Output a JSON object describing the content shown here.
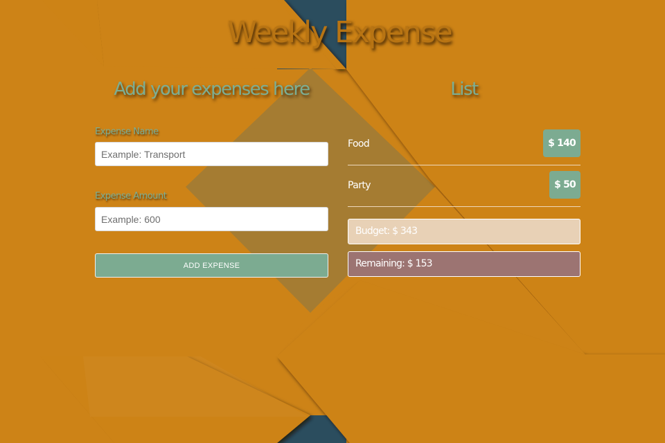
{
  "page": {
    "title": "Weekly Expense"
  },
  "form": {
    "heading": "Add your expenses here",
    "name_label": "Expense Name",
    "name_placeholder": "Example: Transport",
    "name_value": "",
    "amount_label": "Expense Amount",
    "amount_placeholder": "Example: 600",
    "amount_value": "",
    "submit_label": "ADD EXPENSE"
  },
  "list": {
    "heading": "List",
    "items": [
      {
        "name": "Food",
        "amount": "$ 140"
      },
      {
        "name": "Party",
        "amount": "$ 50"
      }
    ],
    "budget": "Budget: $ 343",
    "remaining": "Remaining: $ 153"
  },
  "colors": {
    "background": "#cd8317",
    "accent_green": "#7cab91",
    "budget_bg": "#e8d1b6",
    "remaining_bg": "#9c7472",
    "shape_blue": "#2b4d5e"
  }
}
